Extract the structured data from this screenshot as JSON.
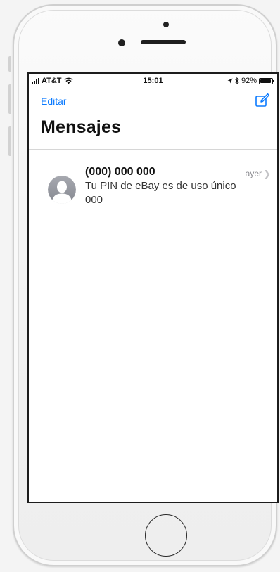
{
  "status_bar": {
    "carrier": "AT&T",
    "time": "15:01",
    "battery_text": "92%",
    "battery_level": 0.92
  },
  "nav": {
    "edit_label": "Editar",
    "compose_icon": "compose-icon"
  },
  "page": {
    "title": "Mensajes"
  },
  "messages": [
    {
      "name": "(000) 000 000",
      "preview": "Tu PIN de eBay es de uso único 000",
      "time": "ayer"
    }
  ],
  "colors": {
    "accent": "#0a7aff",
    "secondary_text": "#8e8e93"
  }
}
